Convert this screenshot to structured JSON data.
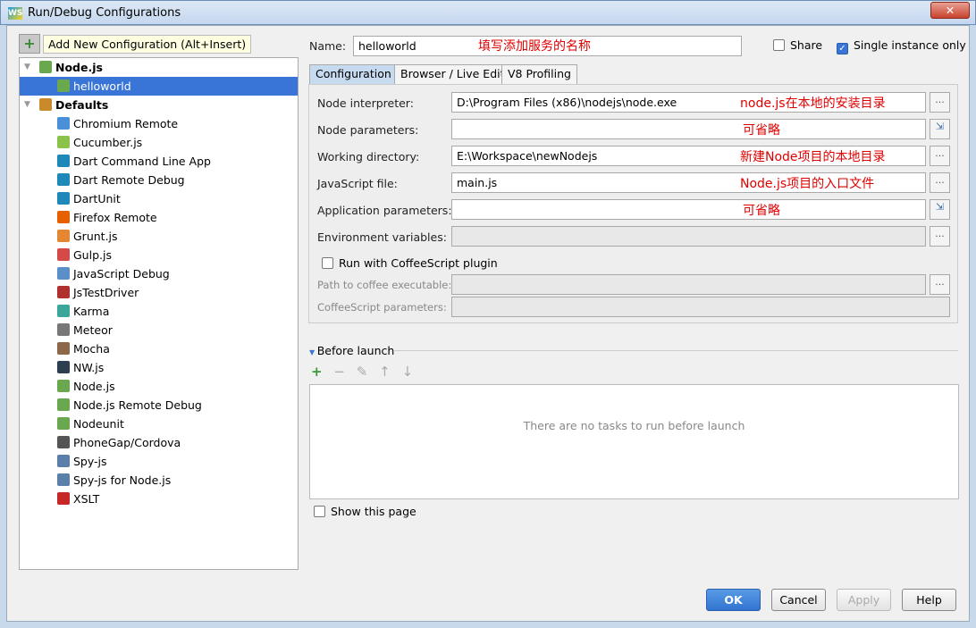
{
  "window": {
    "title": "Run/Debug Configurations",
    "close": "✕"
  },
  "toolbar": {
    "add_icon": "+",
    "tooltip": "Add New Configuration (Alt+Insert)"
  },
  "tree": [
    {
      "label": "Node.js",
      "level": 0,
      "bold": true,
      "color": "#6aa84f"
    },
    {
      "label": "helloworld",
      "level": 1,
      "selected": true,
      "color": "#6aa84f"
    },
    {
      "label": "Defaults",
      "level": 0,
      "bold": true,
      "color": "#c88a2a"
    },
    {
      "label": "Chromium Remote",
      "level": 1,
      "color": "#4a90d9"
    },
    {
      "label": "Cucumber.js",
      "level": 1,
      "color": "#8bc34a"
    },
    {
      "label": "Dart Command Line App",
      "level": 1,
      "color": "#1e88b8"
    },
    {
      "label": "Dart Remote Debug",
      "level": 1,
      "color": "#1e88b8"
    },
    {
      "label": "DartUnit",
      "level": 1,
      "color": "#1e88b8"
    },
    {
      "label": "Firefox Remote",
      "level": 1,
      "color": "#e66000"
    },
    {
      "label": "Grunt.js",
      "level": 1,
      "color": "#e48632"
    },
    {
      "label": "Gulp.js",
      "level": 1,
      "color": "#d34a47"
    },
    {
      "label": "JavaScript Debug",
      "level": 1,
      "color": "#5b8fc7"
    },
    {
      "label": "JsTestDriver",
      "level": 1,
      "color": "#b03030"
    },
    {
      "label": "Karma",
      "level": 1,
      "color": "#3aa79a"
    },
    {
      "label": "Meteor",
      "level": 1,
      "color": "#777777"
    },
    {
      "label": "Mocha",
      "level": 1,
      "color": "#8d6748"
    },
    {
      "label": "NW.js",
      "level": 1,
      "color": "#2c3e50"
    },
    {
      "label": "Node.js",
      "level": 1,
      "color": "#6aa84f"
    },
    {
      "label": "Node.js Remote Debug",
      "level": 1,
      "color": "#6aa84f"
    },
    {
      "label": "Nodeunit",
      "level": 1,
      "color": "#6aa84f"
    },
    {
      "label": "PhoneGap/Cordova",
      "level": 1,
      "color": "#555555"
    },
    {
      "label": "Spy-js",
      "level": 1,
      "color": "#5a7fa8"
    },
    {
      "label": "Spy-js for Node.js",
      "level": 1,
      "color": "#5a7fa8"
    },
    {
      "label": "XSLT",
      "level": 1,
      "color": "#c62828"
    }
  ],
  "name": {
    "label": "Name:",
    "value": "helloworld",
    "note": "填写添加服务的名称"
  },
  "share": {
    "label": "Share",
    "checked": false
  },
  "single_instance": {
    "label": "Single instance only",
    "checked": true
  },
  "tabs": [
    "Configuration",
    "Browser / Live Edit",
    "V8 Profiling"
  ],
  "fields": {
    "node_interpreter": {
      "label": "Node interpreter:",
      "value": "D:\\Program Files (x86)\\nodejs\\node.exe",
      "note": "node.js在本地的安装目录"
    },
    "node_parameters": {
      "label": "Node parameters:",
      "value": "",
      "note": "可省略"
    },
    "working_directory": {
      "label": "Working directory:",
      "value": "E:\\Workspace\\newNodejs",
      "note": "新建Node项目的本地目录"
    },
    "javascript_file": {
      "label": "JavaScript file:",
      "value": "main.js",
      "note": "Node.js项目的入口文件"
    },
    "application_parameters": {
      "label": "Application parameters:",
      "value": "",
      "note": "可省略"
    },
    "environment_variables": {
      "label": "Environment variables:",
      "value": ""
    },
    "coffee_plugin": {
      "label": "Run with CoffeeScript plugin",
      "checked": false
    },
    "coffee_path": {
      "label": "Path to coffee executable:",
      "value": ""
    },
    "coffee_params": {
      "label": "CoffeeScript parameters:",
      "value": ""
    }
  },
  "browse": "...",
  "before_launch": {
    "title": "Before launch",
    "empty": "There are no tasks to run before launch",
    "tools": [
      "+",
      "−",
      "✎",
      "↑",
      "↓"
    ]
  },
  "show_page": {
    "label": "Show this page",
    "checked": false
  },
  "buttons": {
    "ok": "OK",
    "cancel": "Cancel",
    "apply": "Apply",
    "help": "Help"
  }
}
